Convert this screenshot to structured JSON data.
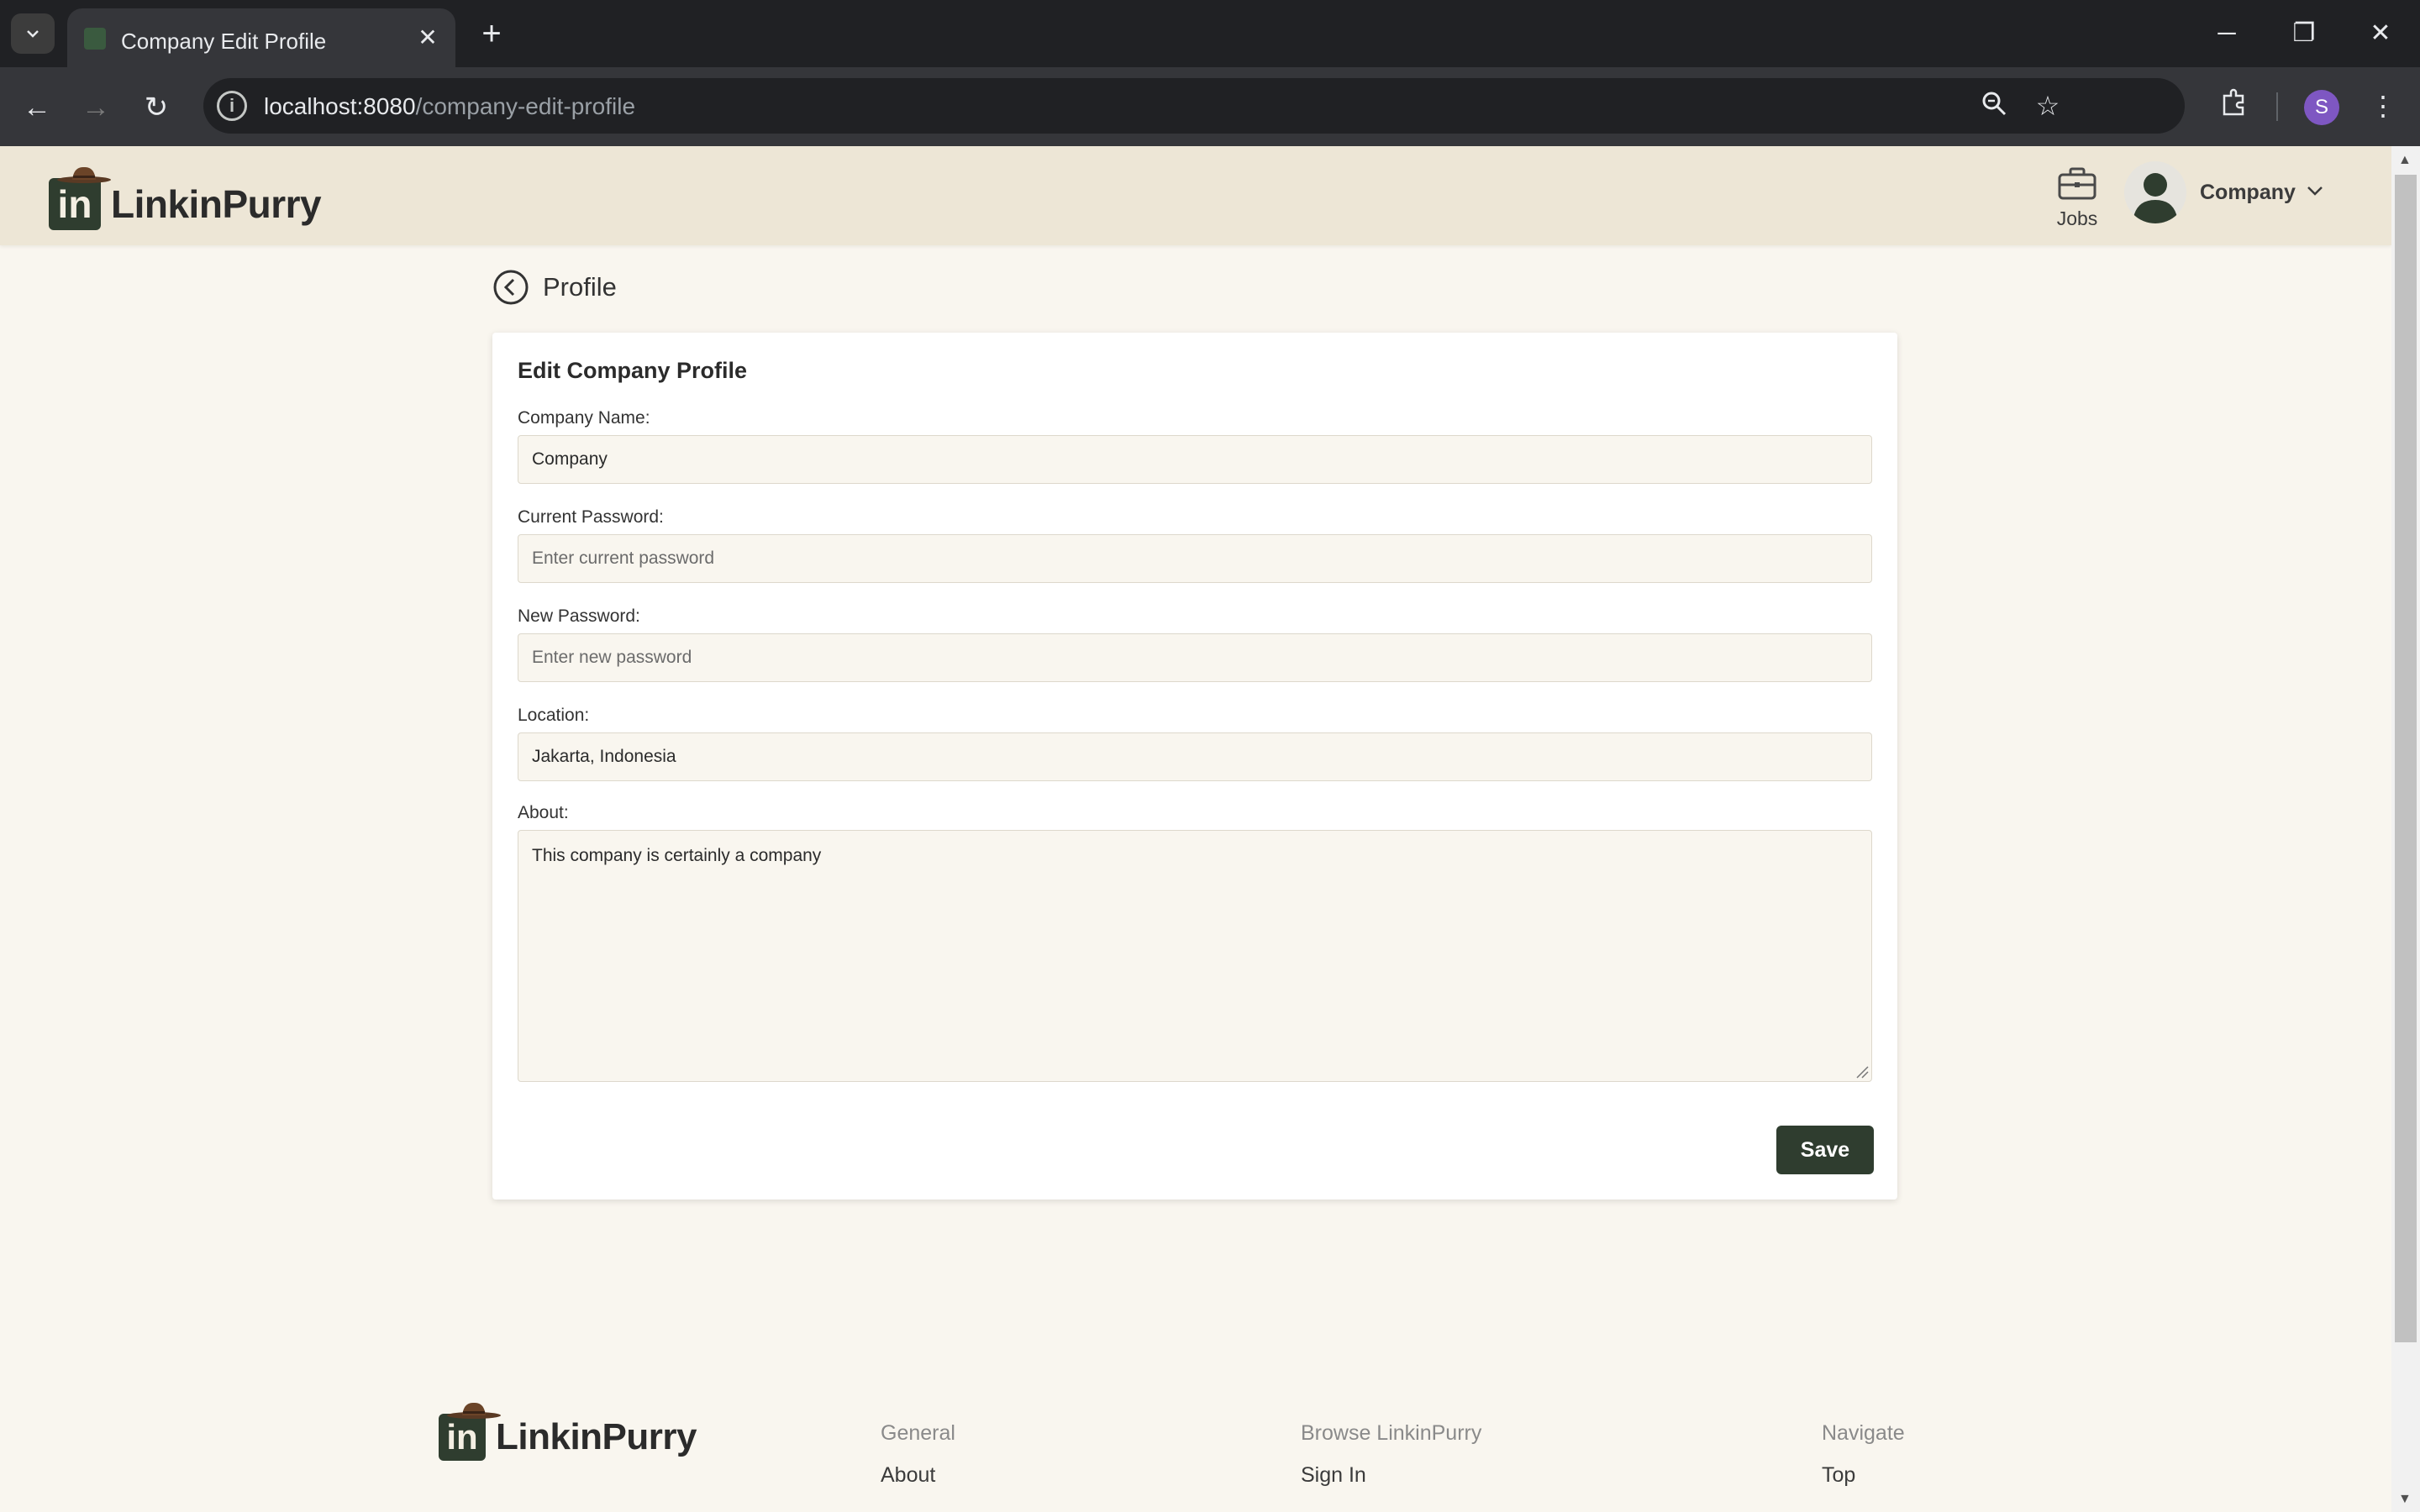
{
  "browser": {
    "tab_title": "Company Edit Profile",
    "url_host": "localhost:8080",
    "url_path": "/company-edit-profile",
    "profile_initial": "S"
  },
  "header": {
    "brand": "LinkinPurry",
    "jobs_label": "Jobs",
    "user_name": "Company"
  },
  "page": {
    "back_title": "Profile"
  },
  "form": {
    "title": "Edit Company Profile",
    "company_name_label": "Company Name:",
    "company_name_value": "Company",
    "current_password_label": "Current Password:",
    "current_password_placeholder": "Enter current password",
    "new_password_label": "New Password:",
    "new_password_placeholder": "Enter new password",
    "location_label": "Location:",
    "location_value": "Jakarta, Indonesia",
    "about_label": "About:",
    "about_value": "This company is certainly a company",
    "save_label": "Save"
  },
  "footer": {
    "brand": "LinkinPurry",
    "columns": [
      {
        "heading": "General",
        "link": "About"
      },
      {
        "heading": "Browse LinkinPurry",
        "link": "Sign In"
      },
      {
        "heading": "Navigate",
        "link": "Top"
      }
    ]
  },
  "colors": {
    "header_bg": "#ede6d6",
    "page_bg": "#f9f6ef",
    "accent": "#2f3d2f"
  }
}
